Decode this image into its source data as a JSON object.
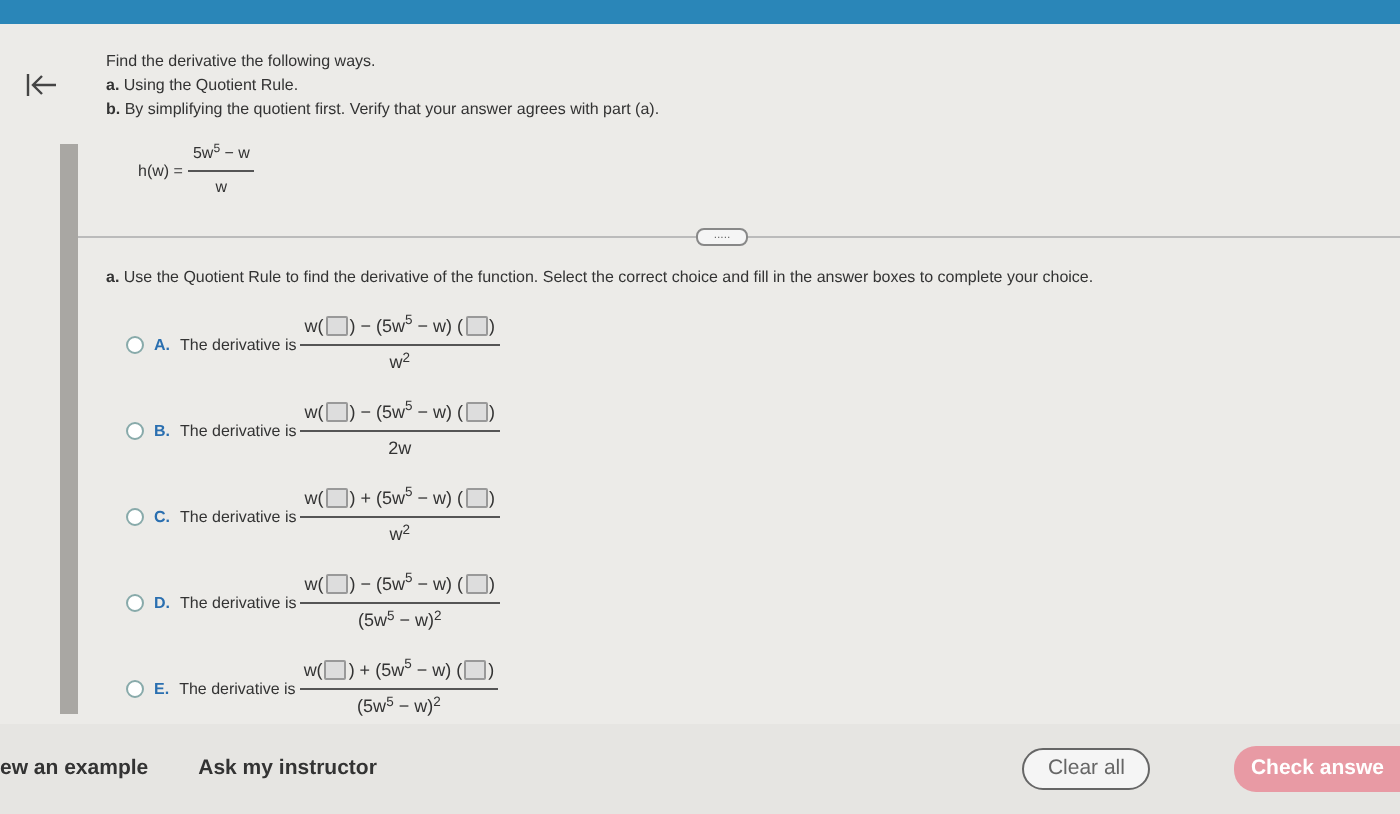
{
  "problem": {
    "intro": "Find the derivative the following ways.",
    "parts": [
      {
        "label": "a.",
        "text": "Using the Quotient Rule."
      },
      {
        "label": "b.",
        "text": "By simplifying the quotient first. Verify that your answer agrees with part (a)."
      }
    ],
    "function": {
      "lhs": "h(w) =",
      "numerator": "5w$^{5}$ − w",
      "denominator": "w"
    }
  },
  "more_button": ".....",
  "question": {
    "label": "a.",
    "text": "Use the Quotient Rule to find the derivative of the function. Select the correct choice and fill in the answer boxes to complete your choice."
  },
  "choices": [
    {
      "letter": "A.",
      "text": "The derivative is",
      "selected": false,
      "numerator": [
        {
          "kind": "text",
          "text": "w("
        },
        {
          "kind": "box"
        },
        {
          "kind": "text",
          "text": ") − (5w$^{5}$ − w) ("
        },
        {
          "kind": "box"
        },
        {
          "kind": "text",
          "text": ")"
        }
      ],
      "denominator": "w$^{2}$"
    },
    {
      "letter": "B.",
      "text": "The derivative is",
      "selected": false,
      "numerator": [
        {
          "kind": "text",
          "text": "w("
        },
        {
          "kind": "box"
        },
        {
          "kind": "text",
          "text": ") − (5w$^{5}$ − w) ("
        },
        {
          "kind": "box"
        },
        {
          "kind": "text",
          "text": ")"
        }
      ],
      "denominator": "2w"
    },
    {
      "letter": "C.",
      "text": "The derivative is",
      "selected": false,
      "numerator": [
        {
          "kind": "text",
          "text": "w("
        },
        {
          "kind": "box"
        },
        {
          "kind": "text",
          "text": ") + (5w$^{5}$ − w) ("
        },
        {
          "kind": "box"
        },
        {
          "kind": "text",
          "text": ")"
        }
      ],
      "denominator": "w$^{2}$"
    },
    {
      "letter": "D.",
      "text": "The derivative is",
      "selected": false,
      "numerator": [
        {
          "kind": "text",
          "text": "w("
        },
        {
          "kind": "box"
        },
        {
          "kind": "text",
          "text": ") − (5w$^{5}$ − w) ("
        },
        {
          "kind": "box"
        },
        {
          "kind": "text",
          "text": ")"
        }
      ],
      "denominator": "(5w$^{5}$ − w)$^{2}$"
    },
    {
      "letter": "E.",
      "text": "The derivative is",
      "selected": false,
      "numerator": [
        {
          "kind": "text",
          "text": "w("
        },
        {
          "kind": "box"
        },
        {
          "kind": "text",
          "text": ") + (5w$^{5}$ − w) ("
        },
        {
          "kind": "box"
        },
        {
          "kind": "text",
          "text": ")"
        }
      ],
      "denominator": "(5w$^{5}$ − w)$^{2}$"
    }
  ],
  "footer": {
    "links": [
      "ew an example",
      "Ask my instructor"
    ],
    "clear_button": "Clear all",
    "check_button": "Check answe"
  }
}
